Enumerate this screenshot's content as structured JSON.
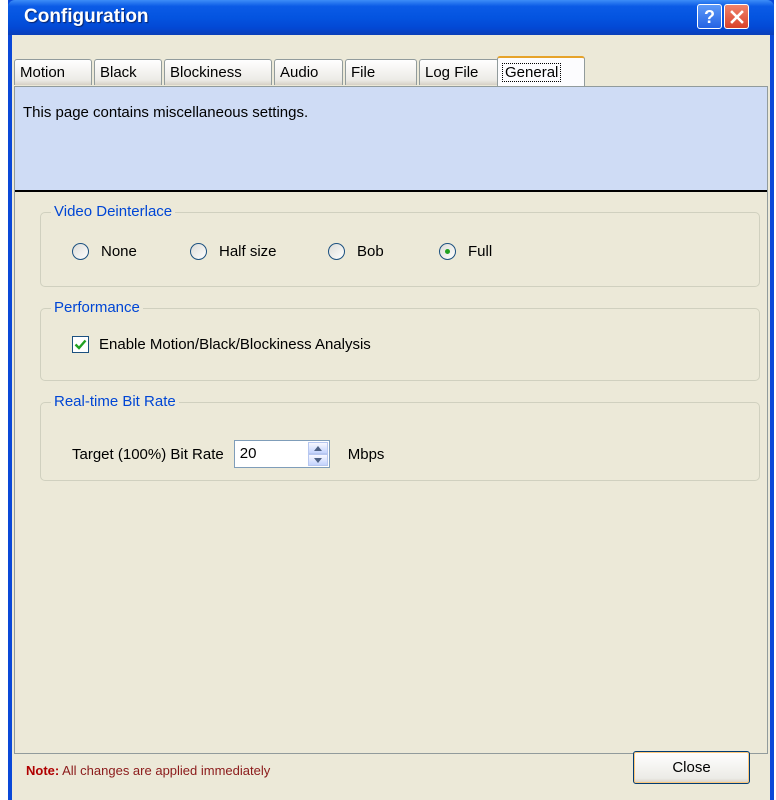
{
  "window": {
    "title": "Configuration"
  },
  "tabs": [
    {
      "label": "Motion"
    },
    {
      "label": "Black"
    },
    {
      "label": "Blockiness"
    },
    {
      "label": "Audio"
    },
    {
      "label": "File"
    },
    {
      "label": "Log File"
    },
    {
      "label": "General",
      "active": true
    }
  ],
  "header": {
    "description": "This page contains miscellaneous settings."
  },
  "video_deinterlace": {
    "title": "Video Deinterlace",
    "options": [
      {
        "label": "None",
        "checked": false
      },
      {
        "label": "Half size",
        "checked": false
      },
      {
        "label": "Bob",
        "checked": false
      },
      {
        "label": "Full",
        "checked": true
      }
    ]
  },
  "performance": {
    "title": "Performance",
    "checkbox_label": "Enable Motion/Black/Blockiness Analysis",
    "checked": true
  },
  "bitrate": {
    "title": "Real-time Bit Rate",
    "label": "Target (100%) Bit Rate",
    "value": "20",
    "unit": "Mbps"
  },
  "footer": {
    "note_label": "Note:",
    "note_text": " All changes are applied immediately",
    "close_label": "Close"
  },
  "colors": {
    "accent": "#0046d5",
    "header_band": "#cfdcf5",
    "title_bar": "#0454e0"
  }
}
